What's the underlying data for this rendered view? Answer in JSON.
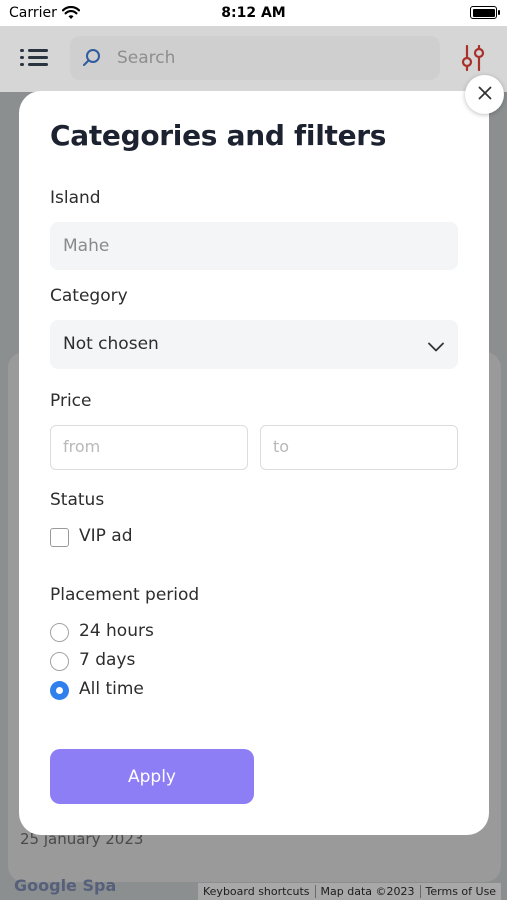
{
  "status_bar": {
    "carrier": "Carrier",
    "time": "8:12 AM"
  },
  "background": {
    "search_placeholder": "Search",
    "listing_date": "25 january 2023",
    "google_logo": "Google Spa",
    "attribution": [
      "Keyboard shortcuts",
      "Map data ©2023",
      "Terms of Use"
    ]
  },
  "modal": {
    "title": "Categories and filters",
    "island": {
      "label": "Island",
      "value": "Mahe"
    },
    "category": {
      "label": "Category",
      "value": "Not chosen"
    },
    "price": {
      "label": "Price",
      "from_placeholder": "from",
      "to_placeholder": "to"
    },
    "status": {
      "label": "Status",
      "vip_label": "VIP ad",
      "vip_checked": false
    },
    "placement_period": {
      "label": "Placement period",
      "options": [
        {
          "label": "24 hours",
          "selected": false
        },
        {
          "label": "7 days",
          "selected": false
        },
        {
          "label": "All time",
          "selected": true
        }
      ]
    },
    "apply_label": "Apply"
  },
  "colors": {
    "accent": "#2f80ed",
    "apply_button": "#8e7ef5",
    "title": "#1d2230"
  },
  "icons": [
    "wifi-icon",
    "battery-icon",
    "menu-icon",
    "search-icon",
    "filter-icon",
    "close-icon",
    "chevron-down-icon"
  ]
}
